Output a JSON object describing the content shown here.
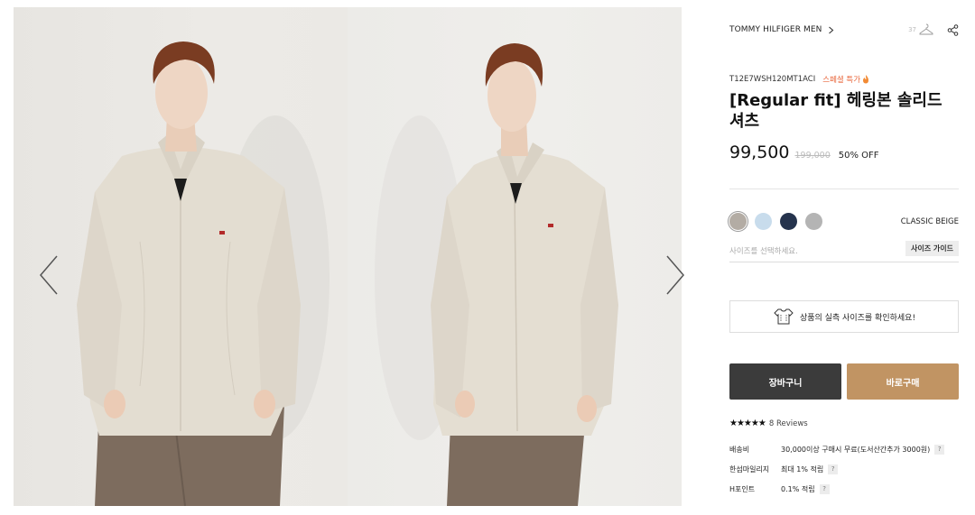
{
  "gallery": {
    "images": [
      {
        "alt": "model-front"
      },
      {
        "alt": "model-angle"
      }
    ]
  },
  "product": {
    "brand": "TOMMY HILFIGER MEN",
    "like_count": "37",
    "code": "T12E7WSH120MT1ACI",
    "special_label": "스페셜 특가",
    "title": "[Regular fit] 헤링본 솔리드 셔츠",
    "price": "99,500",
    "original_price": "199,000",
    "discount": "50% OFF"
  },
  "colors": {
    "swatches": [
      {
        "hex": "#b3aca4",
        "selected": true
      },
      {
        "hex": "#c8dcec",
        "selected": false
      },
      {
        "hex": "#25334d",
        "selected": false
      },
      {
        "hex": "#b4b4b4",
        "selected": false
      }
    ],
    "selected_name": "CLASSIC BEIGE"
  },
  "size": {
    "placeholder": "사이즈를 선택하세요.",
    "guide_label": "사이즈 가이드"
  },
  "fit_check": {
    "label": "상품의 실측 사이즈를 확인하세요!"
  },
  "actions": {
    "cart_label": "장바구니",
    "buy_label": "바로구매"
  },
  "reviews": {
    "stars": "★★★★★",
    "count_label": "8 Reviews"
  },
  "meta": {
    "shipping_label": "배송비",
    "shipping_value": "30,000이상 구매시 무료(도서산간추가 3000원)",
    "mileage_label": "한섬마일리지",
    "mileage_value": "최대 1% 적립",
    "hpoint_label": "H포인트",
    "hpoint_value": "0.1% 적립",
    "help_glyph": "?"
  },
  "colors_theme": {
    "accent": "#c19463",
    "dark": "#3b3b3b",
    "special": "#e8653a"
  }
}
